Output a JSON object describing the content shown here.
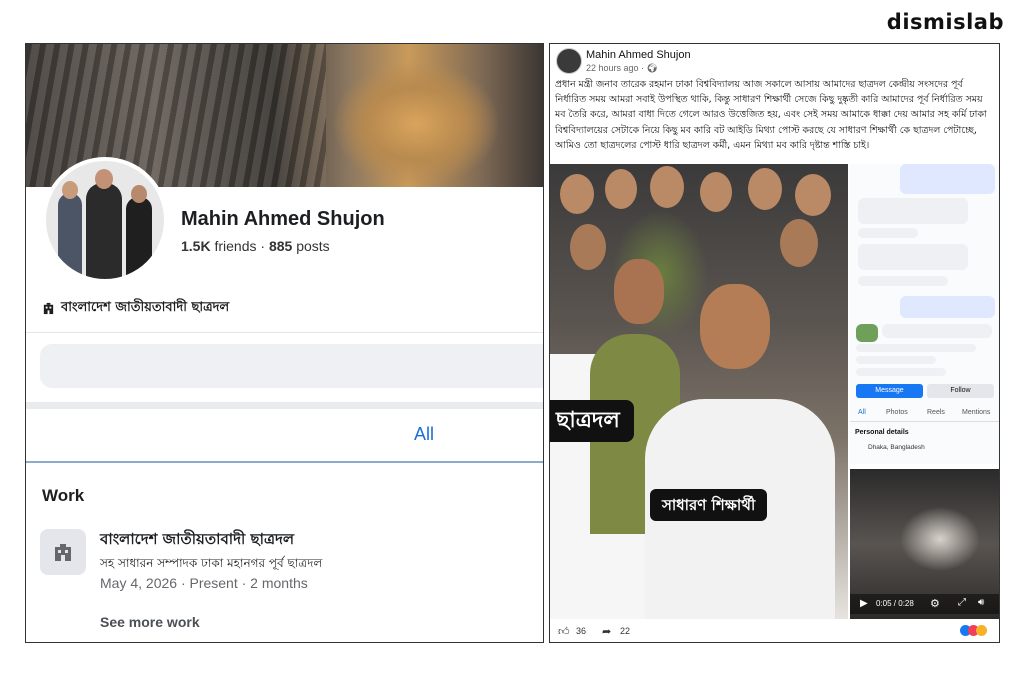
{
  "brand": "dismislab",
  "profile": {
    "name": "Mahin Ahmed Shujon",
    "friends_count": "1.5K",
    "friends_label": "friends",
    "posts_count": "885",
    "posts_label": "posts",
    "affiliation": "বাংলাদেশ জাতীয়তাবাদী ছাত্রদল",
    "tab_all": "All",
    "work_heading": "Work",
    "work_title": "বাংলাদেশ জাতীয়তাবাদী ছাত্রদল",
    "work_subtitle": "সহ সাধারন সম্পাদক ঢাকা মহানগর পূর্ব ছাত্রদল",
    "work_dates": "May 4, 2026 · Present · 2 months",
    "see_more": "See more work"
  },
  "post": {
    "author": "Mahin Ahmed Shujon",
    "time": "22 hours ago ·",
    "text": "প্রধান মন্ত্রী জনাব তারেক রহমান ঢাকা বিশ্ববিদ্যালয় আজ সকালে আসায় আমাদের ছাত্রদল কেন্দ্রীয় সংসদের পূর্ব নির্ধারিত সময় আমরা সবাই উপস্থিত থাকি, কিন্তু সাধারণ শিক্ষার্থী সেজে কিছু দুষ্কৃতী কারি আমাদের পূর্ব নির্ধারিত সময় মব তৈরি করে, আমরা বাধা দিতে গেলে আরও উত্তেজিত হয়, এবং সেই সময় আমাকে ধাক্কা দেয় আমার সহ কর্মি ঢাকা বিশ্ববিদ্যালয়ের সেটাকে নিয়ে কিছু মব কারি বট আইডি মিথ্যা পোস্ট করছে যে সাধারণ শিক্ষার্থী কে ছাত্রদল পেটাচ্ছে, আমিও তো ছাত্রদলের পোস্ট ধারি ছাত্রদল কর্মী, এমন মিথ্যা মব কারি দৃষ্টান্ত শাস্তি চাই।",
    "art_label_1": "ছাত্রদল",
    "art_label_2": "সাধারণ শিক্ষার্থী",
    "side": {
      "message_btn": "Message",
      "follow_btn": "Follow",
      "tabs": [
        "All",
        "Photos",
        "Reels",
        "Mentions"
      ],
      "personal_details": "Personal details",
      "location": "Dhaka, Bangladesh",
      "video_time": "0:05 / 0:28"
    },
    "likes": "36",
    "shares": "22"
  }
}
